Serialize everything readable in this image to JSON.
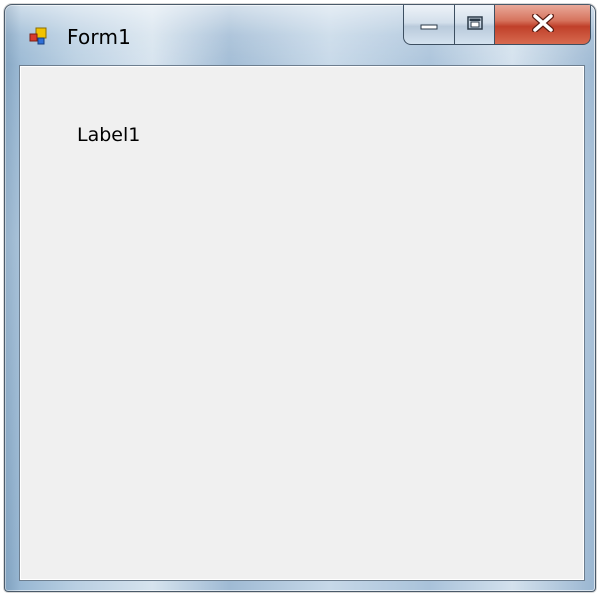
{
  "window": {
    "title": "Form1",
    "app_icon": "winforms-app-icon",
    "caption_buttons": {
      "minimize_icon": "minimize-icon",
      "maximize_icon": "maximize-icon",
      "close_icon": "close-icon"
    }
  },
  "form": {
    "label1": "Label1"
  },
  "colors": {
    "client_background": "#f0f0f0",
    "close_button": "#c0402a",
    "frame_accent": "#9fbad4"
  }
}
